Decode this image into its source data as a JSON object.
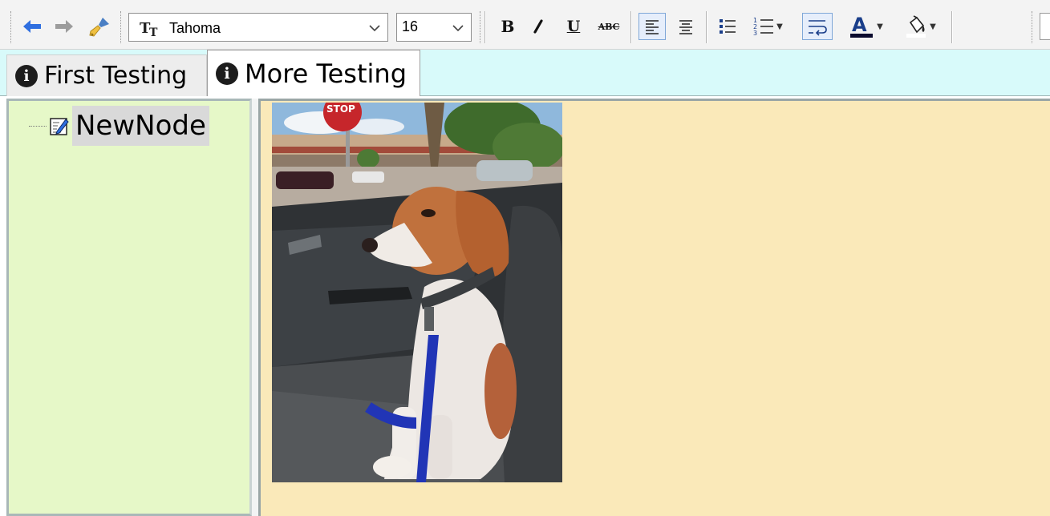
{
  "toolbar": {
    "font_name": "Tahoma",
    "font_size": "16",
    "icons": [
      "back-arrow-icon",
      "forward-arrow-icon",
      "clear-format-brush-icon",
      "font-icon",
      "bold-icon",
      "italic-icon",
      "underline-icon",
      "strikethrough-icon",
      "align-left-icon",
      "align-center-icon",
      "bullet-list-icon",
      "numbered-list-icon",
      "wrap-icon",
      "font-color-icon",
      "highlight-color-icon"
    ],
    "bold_label": "B",
    "italic_label": "I",
    "underline_label": "U",
    "strike_label": "ABC",
    "color_label": "A"
  },
  "tabs": [
    {
      "label": "First Testing",
      "icon": "info-icon",
      "active": false
    },
    {
      "label": "More Testing",
      "icon": "info-icon",
      "active": true
    }
  ],
  "tree": {
    "nodes": [
      {
        "label": "NewNode",
        "icon": "edit-note-icon"
      }
    ]
  },
  "editor": {
    "image": "photo of a brown and white puppy sitting in a car seat",
    "background": "#fae9b9"
  },
  "colors": {
    "accent_blue": "#2f6fe0",
    "tab_strip": "#d8fafa",
    "tree_bg": "#e6f8c8",
    "editor_bg": "#fae9b9"
  }
}
